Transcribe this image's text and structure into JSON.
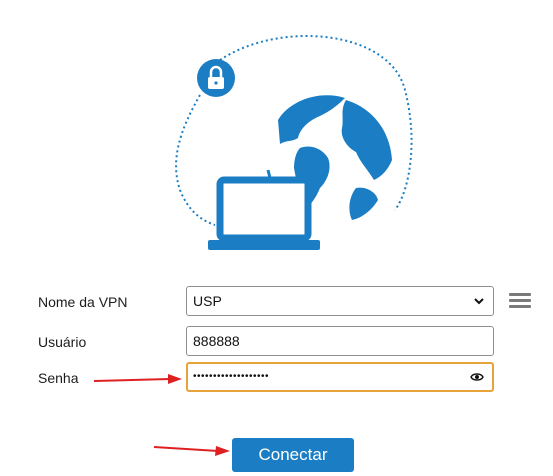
{
  "colors": {
    "brand_blue": "#1b7ec4",
    "focus_border": "#e8a33a",
    "annotation_arrow": "#e02020"
  },
  "hero": {
    "icons": [
      "lock-icon",
      "globe-icon",
      "laptop-icon"
    ]
  },
  "form": {
    "vpn_name": {
      "label": "Nome da VPN",
      "selected": "USP",
      "icon": "chevron-down-icon"
    },
    "username": {
      "label": "Usuário",
      "value": "888888"
    },
    "password": {
      "label": "Senha",
      "masked_value": "•••••••••••••••••••",
      "icon": "eye-icon"
    },
    "menu_icon": "hamburger-menu-icon"
  },
  "actions": {
    "connect_label": "Conectar"
  },
  "annotations": {
    "arrows": [
      "arrow-to-password",
      "arrow-to-connect"
    ]
  }
}
